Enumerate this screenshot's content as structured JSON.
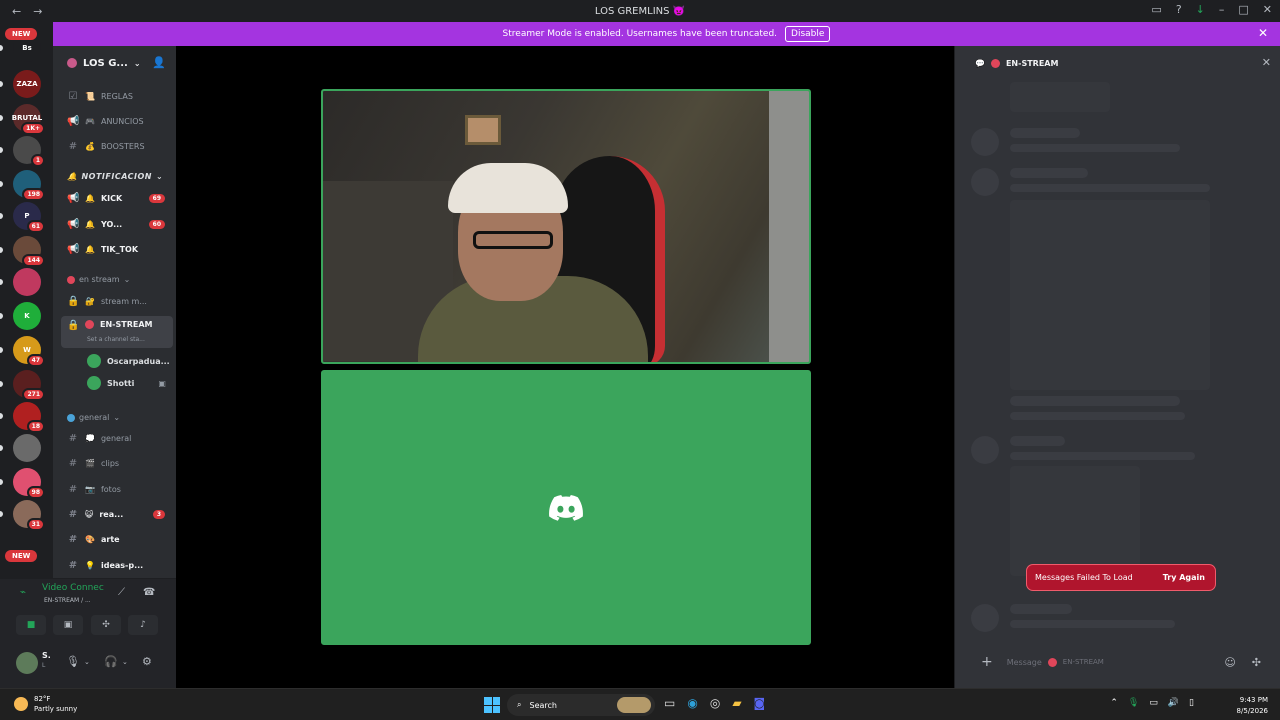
{
  "window": {
    "title": "LOS GREMLINS",
    "title_emoji": "👿",
    "back": "←",
    "forward": "→"
  },
  "banner": {
    "text": "Streamer Mode is enabled. Usernames have been truncated.",
    "button": "Disable"
  },
  "rail": {
    "new_top": "NEW",
    "new_bottom": "NEW",
    "servers": [
      {
        "label": "Bs",
        "color": "#1e1f22",
        "badge": ""
      },
      {
        "label": "ZAZA",
        "color": "#7a1b1b",
        "badge": ""
      },
      {
        "label": "BRUTAL",
        "color": "#5b2a2a",
        "badge": "1K+"
      },
      {
        "label": "",
        "color": "#4a4a4a",
        "badge": "1"
      },
      {
        "label": "",
        "color": "#1f5f7a",
        "badge": "198"
      },
      {
        "label": "P",
        "color": "#2a2a4a",
        "badge": "61"
      },
      {
        "label": "",
        "color": "#6a4a3a",
        "badge": "144"
      },
      {
        "label": "",
        "color": "#c0395f",
        "badge": ""
      },
      {
        "label": "K",
        "color": "#1fae3a",
        "badge": ""
      },
      {
        "label": "W",
        "color": "#d69a1a",
        "badge": "47"
      },
      {
        "label": "",
        "color": "#5a1f1f",
        "badge": "271"
      },
      {
        "label": "",
        "color": "#b02020",
        "badge": "18"
      },
      {
        "label": "",
        "color": "#6a6a6a",
        "badge": ""
      },
      {
        "label": "",
        "color": "#e05070",
        "badge": "98"
      },
      {
        "label": "",
        "color": "#8a6a5a",
        "badge": "31"
      }
    ]
  },
  "sidebar": {
    "server_name": "LOS G...",
    "channels_top": [
      {
        "icon": "☑",
        "emoji": "📜",
        "label": "REGLAS"
      },
      {
        "icon": "📢",
        "emoji": "🎮",
        "label": "ANUNCIOS"
      },
      {
        "icon": "#",
        "emoji": "💰",
        "label": "BOOSTERS"
      }
    ],
    "cat_notif": "NOTIFICACION",
    "channels_notif": [
      {
        "icon": "📢",
        "emoji": "🔔",
        "label": "KICK",
        "count": "69"
      },
      {
        "icon": "📢",
        "emoji": "🔔",
        "label": "YO...",
        "count": "60"
      },
      {
        "icon": "📢",
        "emoji": "🔔",
        "label": "TIK_TOK",
        "count": ""
      }
    ],
    "cat_stream": "en stream",
    "stream_channel": "stream m...",
    "active_channel": "EN-STREAM",
    "active_status": "Set a channel sta...",
    "voice_users": [
      "Oscarpadua...",
      "Shotti"
    ],
    "cat_general": "general",
    "channels_general": [
      {
        "icon": "#",
        "emoji": "💭",
        "label": "general",
        "count": ""
      },
      {
        "icon": "#",
        "emoji": "🎬",
        "label": "clips",
        "count": ""
      },
      {
        "icon": "#",
        "emoji": "📷",
        "label": "fotos",
        "count": ""
      },
      {
        "icon": "#",
        "emoji": "😺",
        "label": "rea...",
        "count": "3"
      },
      {
        "icon": "#",
        "emoji": "🎨",
        "label": "arte",
        "count": ""
      },
      {
        "icon": "#",
        "emoji": "💡",
        "label": "ideas-p...",
        "count": ""
      }
    ]
  },
  "voice_panel": {
    "title": "Video Connec",
    "subtitle": "EN-STREAM / ..."
  },
  "user_panel": {
    "name": "S.",
    "status": "L"
  },
  "chat": {
    "channel": "EN-STREAM",
    "error": "Messages Failed To Load",
    "retry": "Try Again",
    "message_placeholder": "Message",
    "placeholder_channel": "EN-STREAM"
  },
  "taskbar": {
    "temp": "82°F",
    "condition": "Partly sunny",
    "search": "Search",
    "time": "9:43 PM",
    "date": "8/5/2026"
  }
}
